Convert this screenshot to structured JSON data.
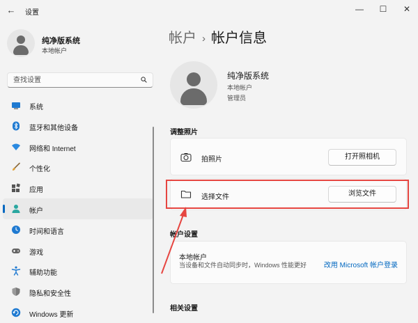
{
  "window": {
    "back": "←",
    "title": "设置",
    "minimize": "—",
    "maximize": "☐",
    "close": "✕"
  },
  "sidebar": {
    "profile": {
      "name": "纯净版系统",
      "account_type": "本地帐户"
    },
    "search": {
      "placeholder": "查找设置"
    },
    "items": [
      {
        "label": "系统",
        "icon": "system-icon",
        "active": false
      },
      {
        "label": "蓝牙和其他设备",
        "icon": "bluetooth-icon",
        "active": false
      },
      {
        "label": "网络和 Internet",
        "icon": "network-icon",
        "active": false
      },
      {
        "label": "个性化",
        "icon": "brush-icon",
        "active": false
      },
      {
        "label": "应用",
        "icon": "apps-icon",
        "active": false
      },
      {
        "label": "帐户",
        "icon": "account-icon",
        "active": true
      },
      {
        "label": "时间和语言",
        "icon": "time-language-icon",
        "active": false
      },
      {
        "label": "游戏",
        "icon": "gamepad-icon",
        "active": false
      },
      {
        "label": "辅助功能",
        "icon": "accessibility-icon",
        "active": false
      },
      {
        "label": "隐私和安全性",
        "icon": "shield-icon",
        "active": false
      },
      {
        "label": "Windows 更新",
        "icon": "windows-update-icon",
        "active": false
      }
    ]
  },
  "main": {
    "breadcrumb": {
      "parent": "帐户",
      "separator": "›",
      "current": "帐户信息"
    },
    "account": {
      "name": "纯净版系统",
      "type": "本地帐户",
      "role": "管理员"
    },
    "adjust_photo": {
      "heading": "调整照片",
      "take_photo": {
        "label": "拍照片",
        "button": "打开照相机"
      },
      "choose_file": {
        "label": "选择文件",
        "button": "浏览文件"
      }
    },
    "account_settings": {
      "heading": "帐户设置",
      "local_title": "本地帐户",
      "local_desc": "当设备和文件自动同步时，Windows 性能更好",
      "link": "改用 Microsoft 帐户登录"
    },
    "related": {
      "heading": "相关设置"
    }
  },
  "colors": {
    "accent": "#0067c0",
    "highlight": "#e64540",
    "background": "#f3f3f3"
  }
}
